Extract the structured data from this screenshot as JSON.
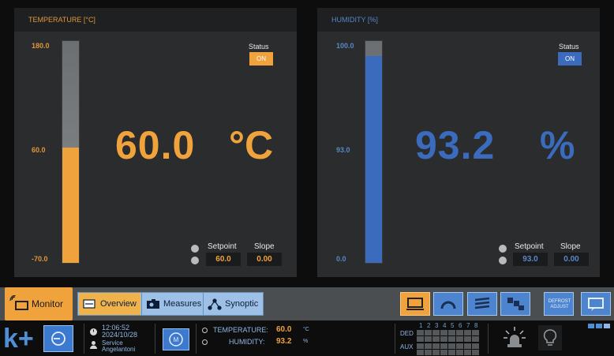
{
  "temperature_panel": {
    "title": "TEMPERATURE [°C]",
    "scale_max": "180.0",
    "scale_mid": "60.0",
    "scale_min": "-70.0",
    "fill_fraction": 0.52,
    "value": "60.0",
    "unit": "°C",
    "status_label": "Status",
    "status_value": "ON",
    "setpoint_label": "Setpoint",
    "setpoint_value": "60.0",
    "slope_label": "Slope",
    "slope_value": "0.00",
    "accent": "#f0a33c"
  },
  "humidity_panel": {
    "title": "HUMIDITY [%]",
    "scale_max": "100.0",
    "scale_mid": "93.0",
    "scale_min": "0.0",
    "fill_fraction": 0.932,
    "value": "93.2",
    "unit": "%",
    "status_label": "Status",
    "status_value": "ON",
    "setpoint_label": "Setpoint",
    "setpoint_value": "93.0",
    "slope_label": "Slope",
    "slope_value": "0.00",
    "accent": "#3a6bbd"
  },
  "navbar": {
    "monitor_label": "Monitor",
    "overview_label": "Overview",
    "measures_label": "Measures",
    "synoptic_label": "Synoptic",
    "defrost_label": "DEFROST ADJUST",
    "right_buttons": [
      "monitor-icon",
      "gauge-icon",
      "layers-icon",
      "network-icon",
      "defrost-icon",
      "chat-icon"
    ]
  },
  "statusbar": {
    "logo": "k+",
    "time": "12:06:52",
    "date": "2024/10/28",
    "user_line1": "Service",
    "user_line2": "Angelantoni",
    "m_button": "M",
    "temp_label": "TEMPERATURE:",
    "temp_value": "60.0",
    "temp_unit": "°C",
    "hum_label": "HUMIDITY:",
    "hum_value": "93.2",
    "hum_unit": "%",
    "ded_label": "DED",
    "aux_label": "AUX",
    "channel_numbers": [
      "1",
      "2",
      "3",
      "4",
      "5",
      "6",
      "7",
      "8"
    ]
  }
}
